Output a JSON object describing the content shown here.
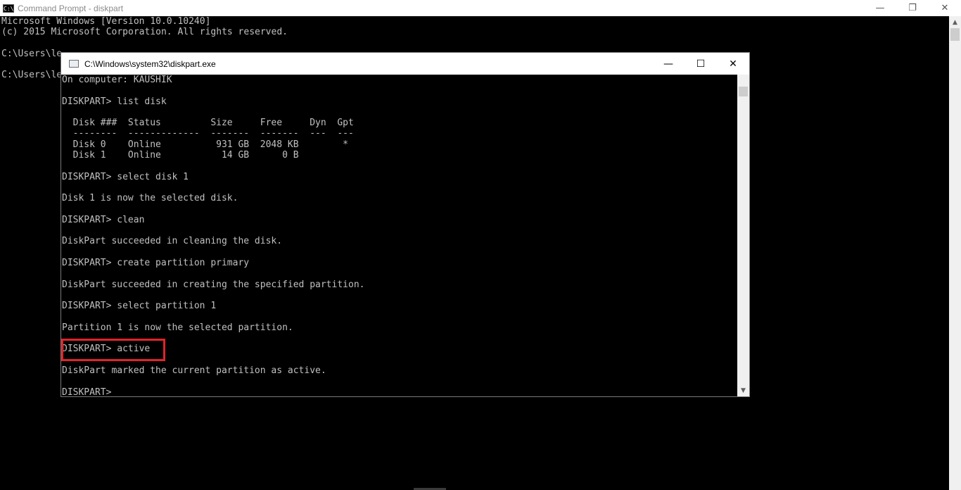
{
  "outer_window": {
    "title": "Command Prompt - diskpart",
    "icon_label": "C:\\",
    "lines": [
      "Microsoft Windows [Version 10.0.10240]",
      "(c) 2015 Microsoft Corporation. All rights reserved.",
      "",
      "C:\\Users\\le",
      "",
      "C:\\Users\\le"
    ]
  },
  "inner_window": {
    "title": "C:\\Windows\\system32\\diskpart.exe",
    "lines": [
      "On computer: KAUSHIK",
      "",
      "DISKPART> list disk",
      "",
      "  Disk ###  Status         Size     Free     Dyn  Gpt",
      "  --------  -------------  -------  -------  ---  ---",
      "  Disk 0    Online          931 GB  2048 KB        *",
      "  Disk 1    Online           14 GB      0 B",
      "",
      "DISKPART> select disk 1",
      "",
      "Disk 1 is now the selected disk.",
      "",
      "DISKPART> clean",
      "",
      "DiskPart succeeded in cleaning the disk.",
      "",
      "DISKPART> create partition primary",
      "",
      "DiskPart succeeded in creating the specified partition.",
      "",
      "DISKPART> select partition 1",
      "",
      "Partition 1 is now the selected partition.",
      "",
      "DISKPART> active",
      "",
      "DiskPart marked the current partition as active.",
      "",
      "DISKPART>"
    ]
  },
  "controls": {
    "minimize": "—",
    "maximize": "☐",
    "restore": "❐",
    "close": "✕"
  },
  "colors": {
    "console_bg": "#000000",
    "console_text": "#c0c0c0",
    "highlight": "#e0242a"
  }
}
